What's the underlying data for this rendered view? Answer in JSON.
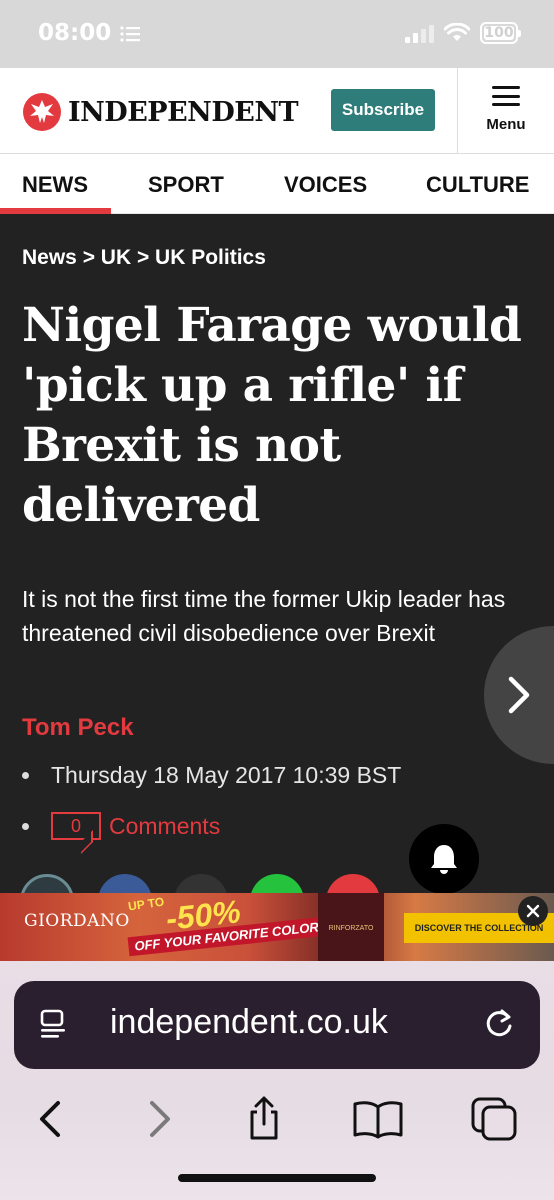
{
  "status_bar": {
    "time": "08:00",
    "battery": "100"
  },
  "header": {
    "logo_text": "INDEPENDENT",
    "subscribe_label": "Subscribe",
    "menu_label": "Menu"
  },
  "nav": {
    "tabs": [
      {
        "label": "NEWS",
        "active": true
      },
      {
        "label": "SPORT"
      },
      {
        "label": "VOICES"
      },
      {
        "label": "CULTURE"
      }
    ]
  },
  "article": {
    "breadcrumb": "News > UK > UK Politics",
    "headline": "Nigel Farage would 'pick up a rifle' if Brexit is not delivered",
    "standfirst": "It is not the first time the former Ukip leader has threatened civil disobedience over Brexit",
    "author": "Tom Peck",
    "date": "Thursday 18 May 2017 10:39 BST",
    "comment_count": "0",
    "comments_label": "Comments"
  },
  "ad": {
    "brand": "GIORDANO",
    "upto": "UP TO",
    "discount": "-50%",
    "offer": "OFF YOUR FAVORITE COLOR",
    "bottle_label": "RINFORZATO",
    "cta": "DISCOVER THE COLLECTION"
  },
  "browser": {
    "url": "independent.co.uk"
  },
  "colors": {
    "accent_red": "#e33a3f",
    "subscribe_teal": "#2e7d7a",
    "article_bg": "#222222"
  }
}
